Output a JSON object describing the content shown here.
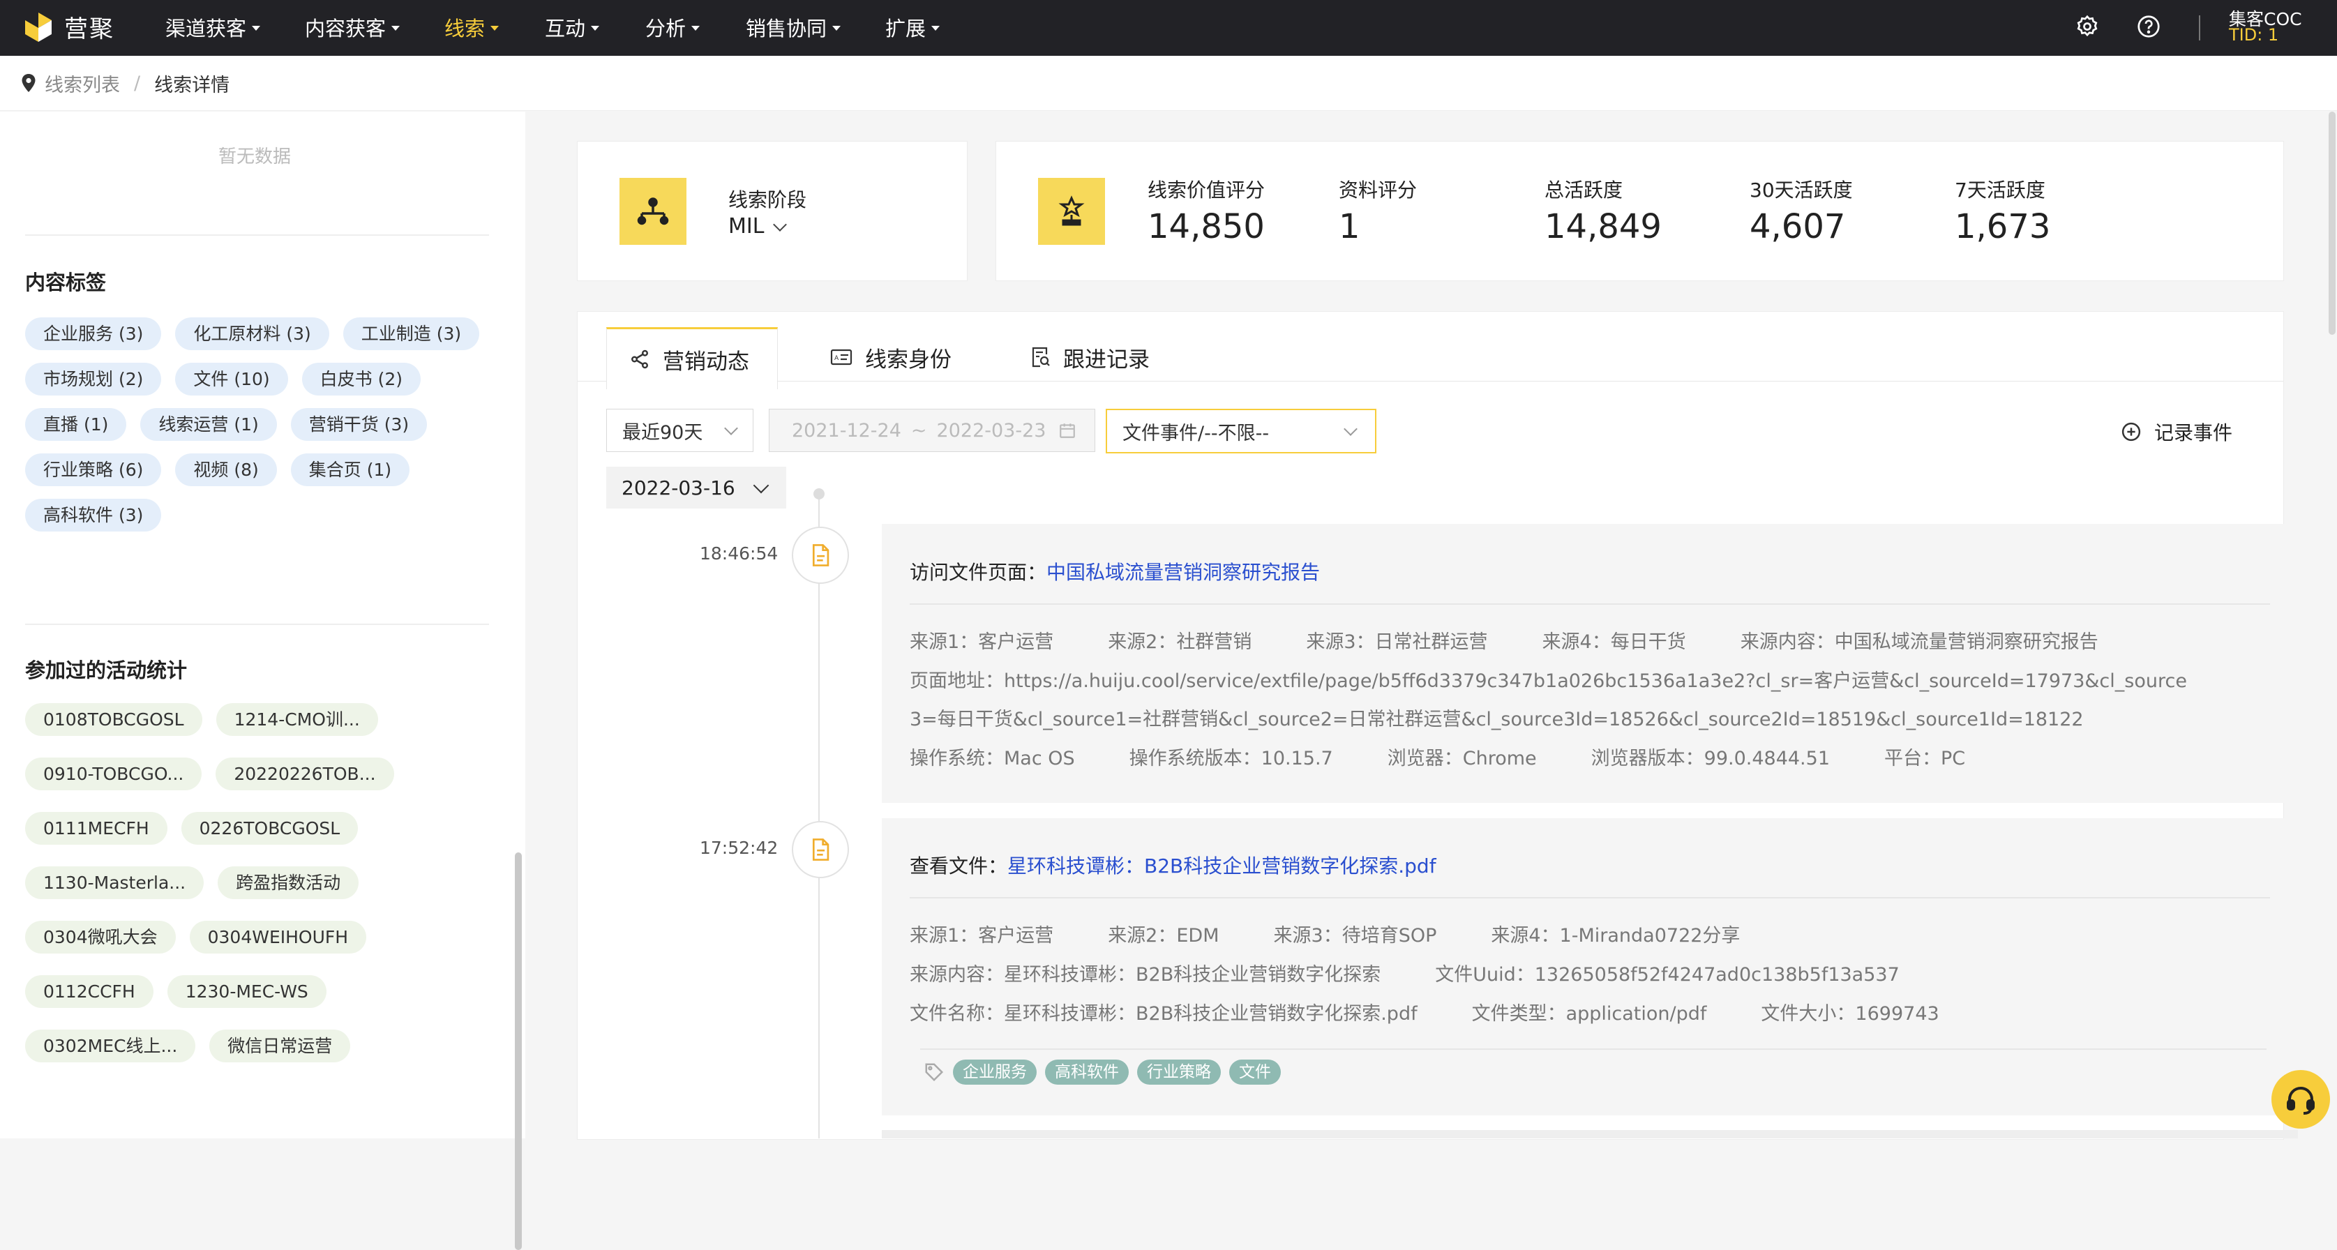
{
  "app": {
    "brand": "营聚"
  },
  "nav": {
    "items": [
      {
        "label": "渠道获客"
      },
      {
        "label": "内容获客"
      },
      {
        "label": "线索"
      },
      {
        "label": "互动"
      },
      {
        "label": "分析"
      },
      {
        "label": "销售协同"
      },
      {
        "label": "扩展"
      }
    ],
    "user_name": "集客COC",
    "user_tid": "TID: 1"
  },
  "breadcrumb": {
    "parent": "线索列表",
    "separator": "/",
    "current": "线索详情"
  },
  "sidebar": {
    "empty_text": "暂无数据",
    "content_tags_title": "内容标签",
    "content_tags": [
      "企业服务 (3)",
      "化工原材料 (3)",
      "工业制造 (3)",
      "市场规划 (2)",
      "文件 (10)",
      "白皮书 (2)",
      "直播 (1)",
      "线索运营 (1)",
      "营销干货 (3)",
      "行业策略 (6)",
      "视频 (8)",
      "集合页 (1)",
      "高科软件 (3)"
    ],
    "activity_title": "参加过的活动统计",
    "activities": [
      "0108TOBCGOSL",
      "1214-CMO训...",
      "0910-TOBCGO...",
      "20220226TOB...",
      "0111MECFH",
      "0226TOBCGOSL",
      "1130-Masterla...",
      "跨盈指数活动",
      "0304微吼大会",
      "0304WEIHOUFH",
      "0112CCFH",
      "1230-MEC-WS",
      "0302MEC线上...",
      "微信日常运营"
    ]
  },
  "stage_card": {
    "label": "线索阶段",
    "value": "MIL"
  },
  "metrics": [
    {
      "label": "线索价值评分",
      "value": "14,850"
    },
    {
      "label": "资料评分",
      "value": "1"
    },
    {
      "label": "总活跃度",
      "value": "14,849"
    },
    {
      "label": "30天活跃度",
      "value": "4,607"
    },
    {
      "label": "7天活跃度",
      "value": "1,673"
    }
  ],
  "tabs": [
    {
      "label": "营销动态"
    },
    {
      "label": "线索身份"
    },
    {
      "label": "跟进记录"
    }
  ],
  "filters": {
    "range": "最近90天",
    "date_start": "2021-12-24",
    "date_sep": "~",
    "date_end": "2022-03-23",
    "event_type": "文件事件/--不限--",
    "record_event": "记录事件",
    "date_group": "2022-03-16"
  },
  "events": [
    {
      "time": "18:46:54",
      "action": "访问文件页面：",
      "target": "中国私域流量营销洞察研究报告",
      "row1": [
        "来源1：客户运营",
        "来源2：社群营销",
        "来源3：日常社群运营",
        "来源4：每日干货",
        "来源内容：中国私域流量营销洞察研究报告"
      ],
      "url_line1": "页面地址：https://a.huiju.cool/service/extfile/page/b5ff6d3379c347b1a026bc1536a1a3e2?cl_sr=客户运营&cl_sourceId=17973&cl_source",
      "url_line2": "3=每日干货&cl_source1=社群营销&cl_source2=日常社群运营&cl_source3Id=18526&cl_source2Id=18519&cl_source1Id=18122",
      "row_sys": [
        "操作系统：Mac OS",
        "操作系统版本：10.15.7",
        "浏览器：Chrome",
        "浏览器版本：99.0.4844.51",
        "平台：PC"
      ]
    },
    {
      "time": "17:52:42",
      "action": "查看文件：",
      "target": "星环科技谭彬：B2B科技企业营销数字化探索.pdf",
      "row1": [
        "来源1：客户运营",
        "来源2：EDM",
        "来源3：待培育SOP",
        "来源4：1-Miranda0722分享"
      ],
      "row2": [
        "来源内容：星环科技谭彬：B2B科技企业营销数字化探索",
        "文件Uuid：13265058f52f4247ad0c138b5f13a537"
      ],
      "row3": [
        "文件名称：星环科技谭彬：B2B科技企业营销数字化探索.pdf",
        "文件类型：application/pdf",
        "文件大小：1699743"
      ],
      "tags": [
        "企业服务",
        "高科软件",
        "行业策略",
        "文件"
      ]
    }
  ],
  "colors": {
    "accent": "#f7cd3b",
    "nav_bg": "#222226",
    "link": "#2a4fcf",
    "event_tag": "#8fbab2"
  }
}
